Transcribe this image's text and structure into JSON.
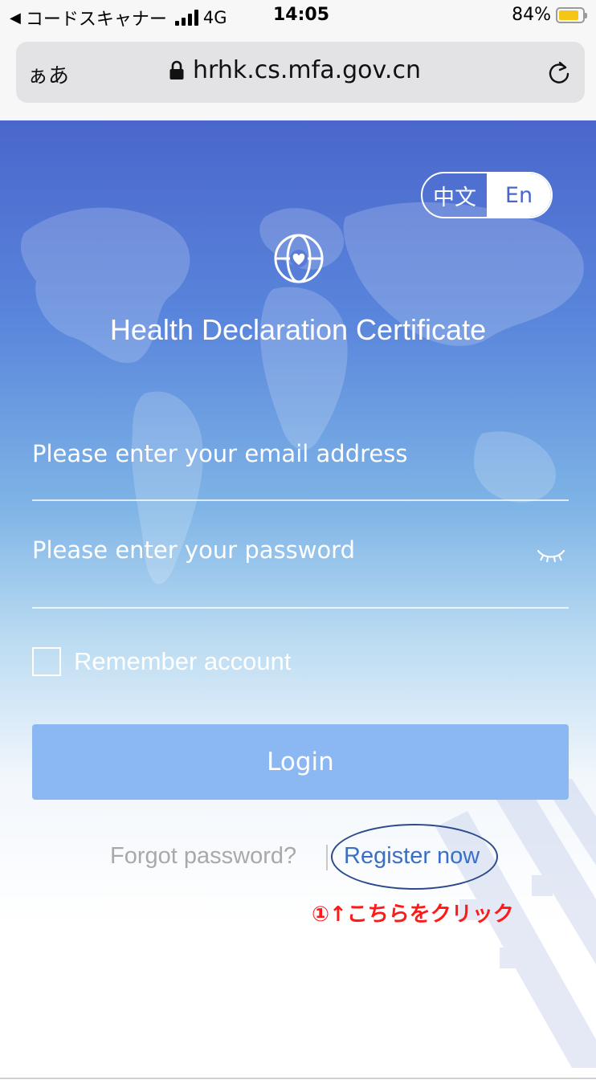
{
  "status_bar": {
    "back_arrow": "◀",
    "back_app": "コードスキャナー",
    "network": "4G",
    "time": "14:05",
    "battery_percent_label": "84%",
    "battery_level": 0.84
  },
  "browser": {
    "text_size_button": "ぁあ",
    "url": "hrhk.cs.mfa.gov.cn",
    "lock_icon": "lock-icon",
    "reload_icon": "reload-icon"
  },
  "page": {
    "language": {
      "zh_label": "中文",
      "en_label": "En",
      "selected": "En"
    },
    "title": "Health Declaration Certificate",
    "email": {
      "value": "",
      "placeholder": "Please enter your email address"
    },
    "password": {
      "value": "",
      "placeholder": "Please enter your password",
      "toggle_icon": "eye-closed-icon"
    },
    "remember_label": "Remember account",
    "remember_checked": false,
    "login_label": "Login",
    "forgot_label": "Forgot password?",
    "register_label": "Register now",
    "annotation": "①↑こちらをクリック"
  },
  "colors": {
    "header_blue": "#4a66cc",
    "login_button": "#8bb8f2",
    "register_link": "#3b6fc4",
    "annotation_red": "#ff1a1a",
    "battery": "#f5c518"
  }
}
